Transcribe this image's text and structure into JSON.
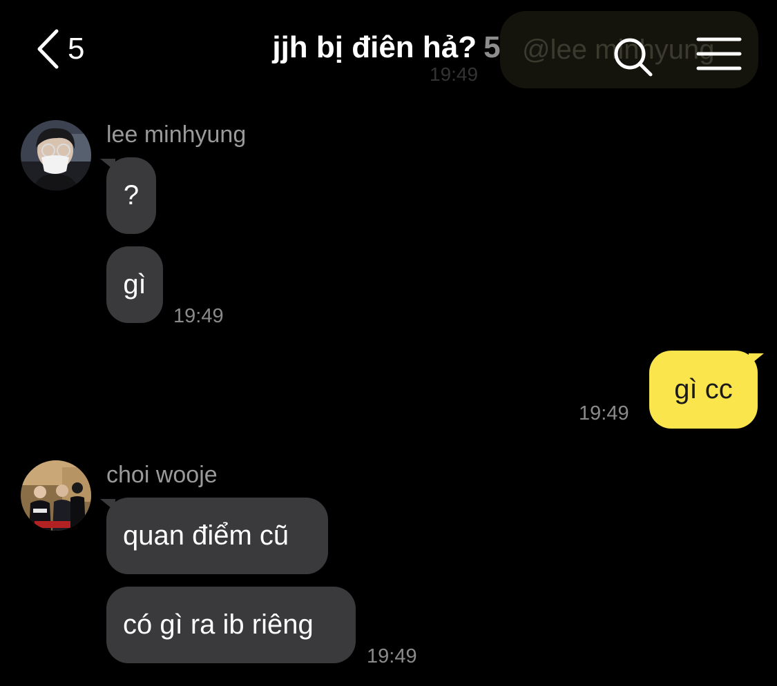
{
  "header": {
    "back_count": "5",
    "title": "jjh bị điên hả?",
    "member_count": "5",
    "ghost_notification_text": "@lee minhyung",
    "ghost_notification_time": "19:49"
  },
  "messages": [
    {
      "sender": "lee minhyung",
      "bubbles": [
        "?",
        "gì"
      ],
      "time": "19:49"
    },
    {
      "sender": "me",
      "bubbles": [
        "gì cc"
      ],
      "time": "19:49"
    },
    {
      "sender": "choi wooje",
      "bubbles": [
        "quan điểm cũ",
        "có gì ra ib riêng"
      ],
      "time": "19:49"
    }
  ],
  "colors": {
    "background": "#000000",
    "incoming_bubble": "#3a3a3c",
    "outgoing_bubble": "#fbe54d",
    "timestamp": "#8a8a8a",
    "sender_name": "#9a9a9a"
  },
  "icons": {
    "back": "chevron-left-icon",
    "search": "search-icon",
    "menu": "hamburger-menu-icon"
  }
}
